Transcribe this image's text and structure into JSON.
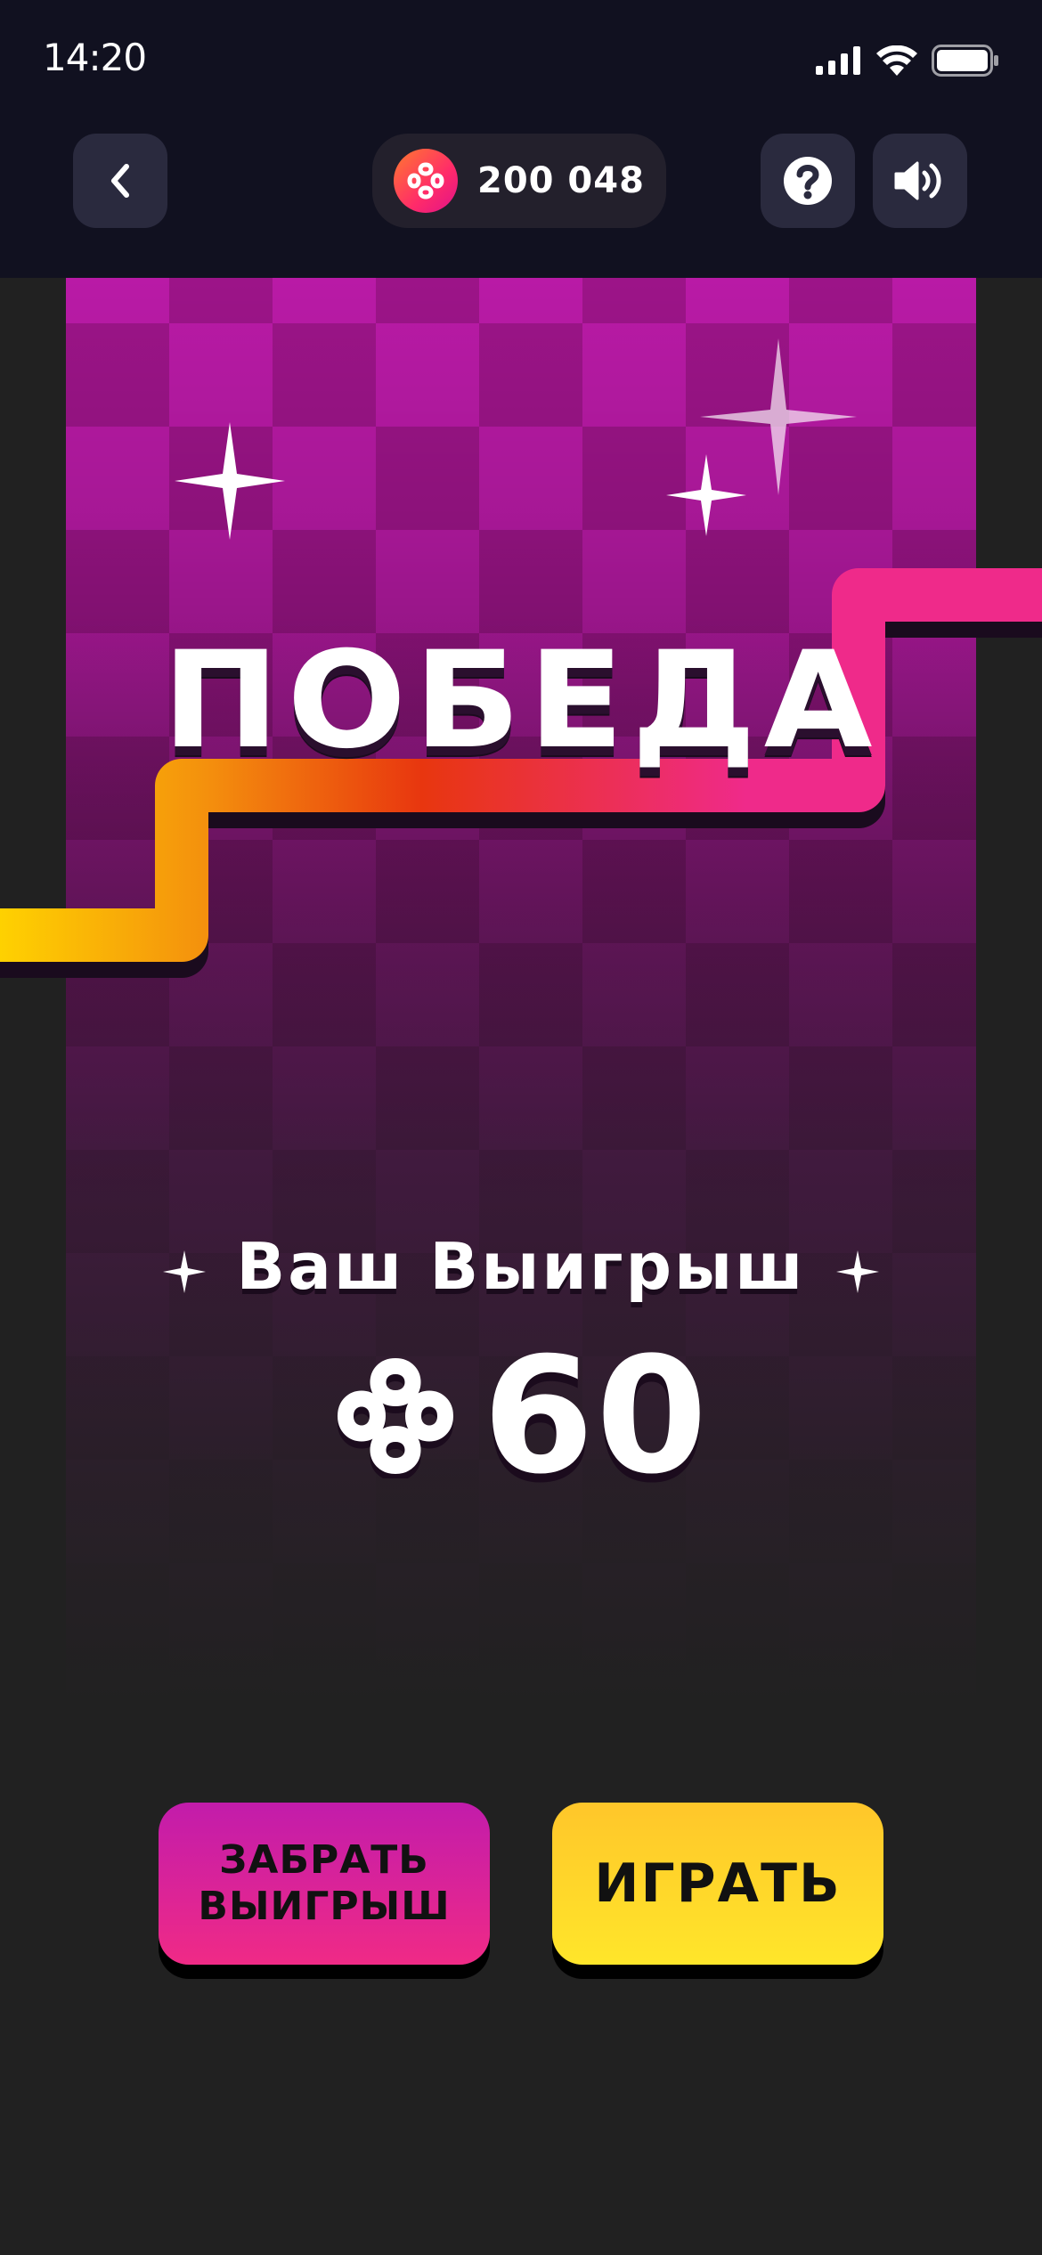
{
  "status_bar": {
    "time": "14:20"
  },
  "header": {
    "back_icon": "chevron-left-icon",
    "balance": "200 048",
    "help_icon": "question-circle-icon",
    "sound_icon": "speaker-icon"
  },
  "game": {
    "title": "ПОБЕДА",
    "win_label": "Ваш Выигрыш",
    "win_amount": "60",
    "colors": {
      "board_light": "#b91aa6",
      "board_dark": "#9c1488",
      "path_start": "#ffd400",
      "path_mid": "#e8360f",
      "path_end": "#ef2a8a",
      "accent_pink": "#f02a86",
      "accent_yellow": "#ffd52a"
    }
  },
  "buttons": {
    "collect_line1": "ЗАБРАТЬ",
    "collect_line2": "ВЫИГРЫШ",
    "play": "ИГРАТЬ"
  }
}
